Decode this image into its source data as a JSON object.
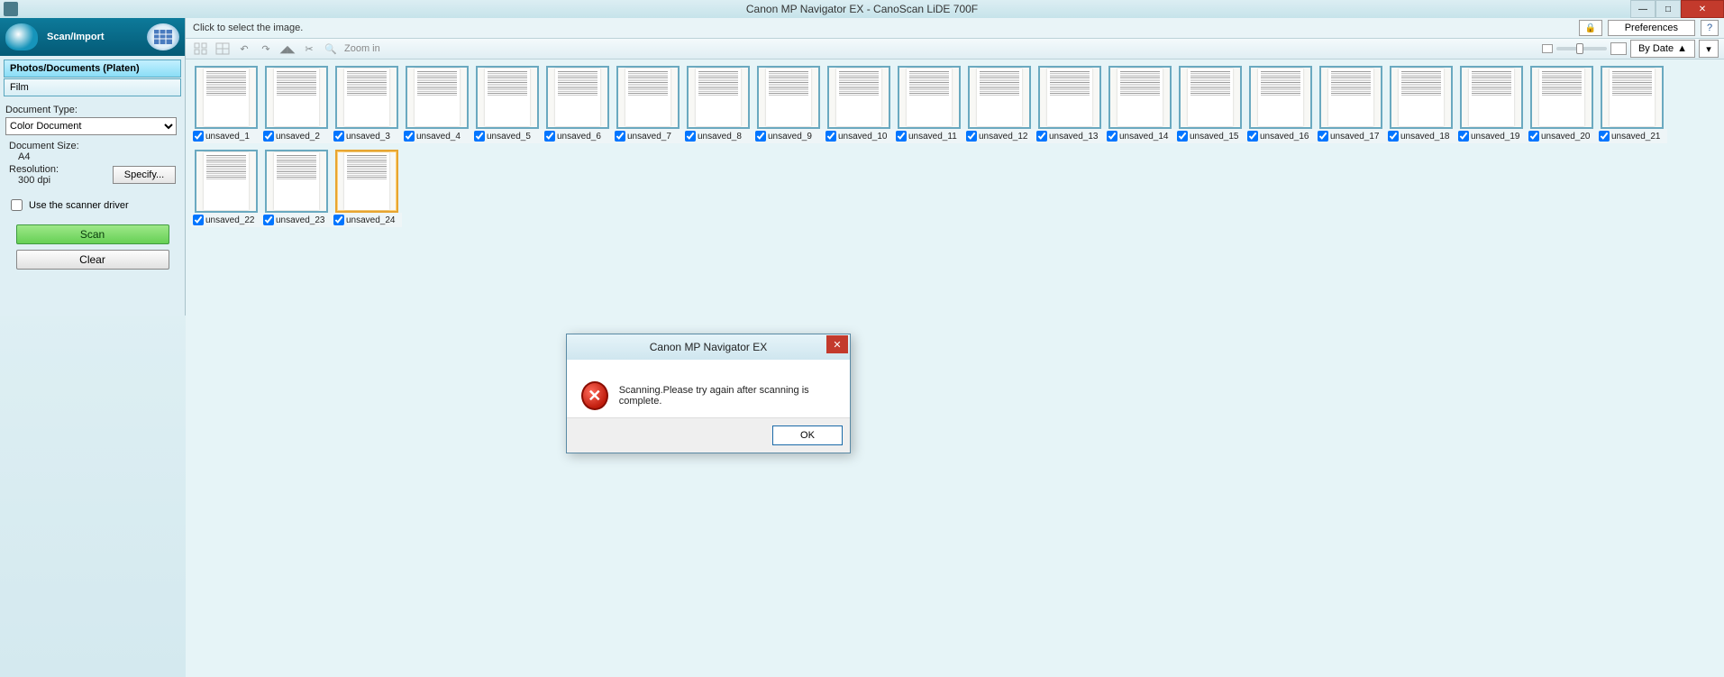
{
  "window": {
    "title": "Canon MP Navigator EX - CanoScan LiDE 700F"
  },
  "prefs": {
    "label": "Preferences",
    "help": "?"
  },
  "sidebar": {
    "header": "Scan/Import",
    "sources": [
      {
        "label": "Photos/Documents (Platen)",
        "active": true
      },
      {
        "label": "Film",
        "active": false
      }
    ],
    "doc_type_label": "Document Type:",
    "doc_type_value": "Color Document",
    "doc_size_label": "Document Size:",
    "doc_size_value": "A4",
    "resolution_label": "Resolution:",
    "resolution_value": "300 dpi",
    "specify_label": "Specify...",
    "use_driver_label": "Use the scanner driver",
    "scan_label": "Scan",
    "clear_label": "Clear"
  },
  "main": {
    "instruction": "Click to select the image.",
    "zoom_label": "Zoom in",
    "sort_label": "By Date",
    "thumbs": [
      {
        "name": "unsaved_1",
        "checked": true
      },
      {
        "name": "unsaved_2",
        "checked": true
      },
      {
        "name": "unsaved_3",
        "checked": true
      },
      {
        "name": "unsaved_4",
        "checked": true
      },
      {
        "name": "unsaved_5",
        "checked": true
      },
      {
        "name": "unsaved_6",
        "checked": true
      },
      {
        "name": "unsaved_7",
        "checked": true
      },
      {
        "name": "unsaved_8",
        "checked": true
      },
      {
        "name": "unsaved_9",
        "checked": true
      },
      {
        "name": "unsaved_10",
        "checked": true
      },
      {
        "name": "unsaved_11",
        "checked": true
      },
      {
        "name": "unsaved_12",
        "checked": true
      },
      {
        "name": "unsaved_13",
        "checked": true
      },
      {
        "name": "unsaved_14",
        "checked": true
      },
      {
        "name": "unsaved_15",
        "checked": true
      },
      {
        "name": "unsaved_16",
        "checked": true
      },
      {
        "name": "unsaved_17",
        "checked": true
      },
      {
        "name": "unsaved_18",
        "checked": true
      },
      {
        "name": "unsaved_19",
        "checked": true
      },
      {
        "name": "unsaved_20",
        "checked": true
      },
      {
        "name": "unsaved_21",
        "checked": true
      },
      {
        "name": "unsaved_22",
        "checked": true
      },
      {
        "name": "unsaved_23",
        "checked": true
      },
      {
        "name": "unsaved_24",
        "checked": true,
        "selected": true
      }
    ]
  },
  "dialog": {
    "title": "Canon MP Navigator EX",
    "message": "Scanning.Please try again after scanning is complete.",
    "ok": "OK"
  }
}
